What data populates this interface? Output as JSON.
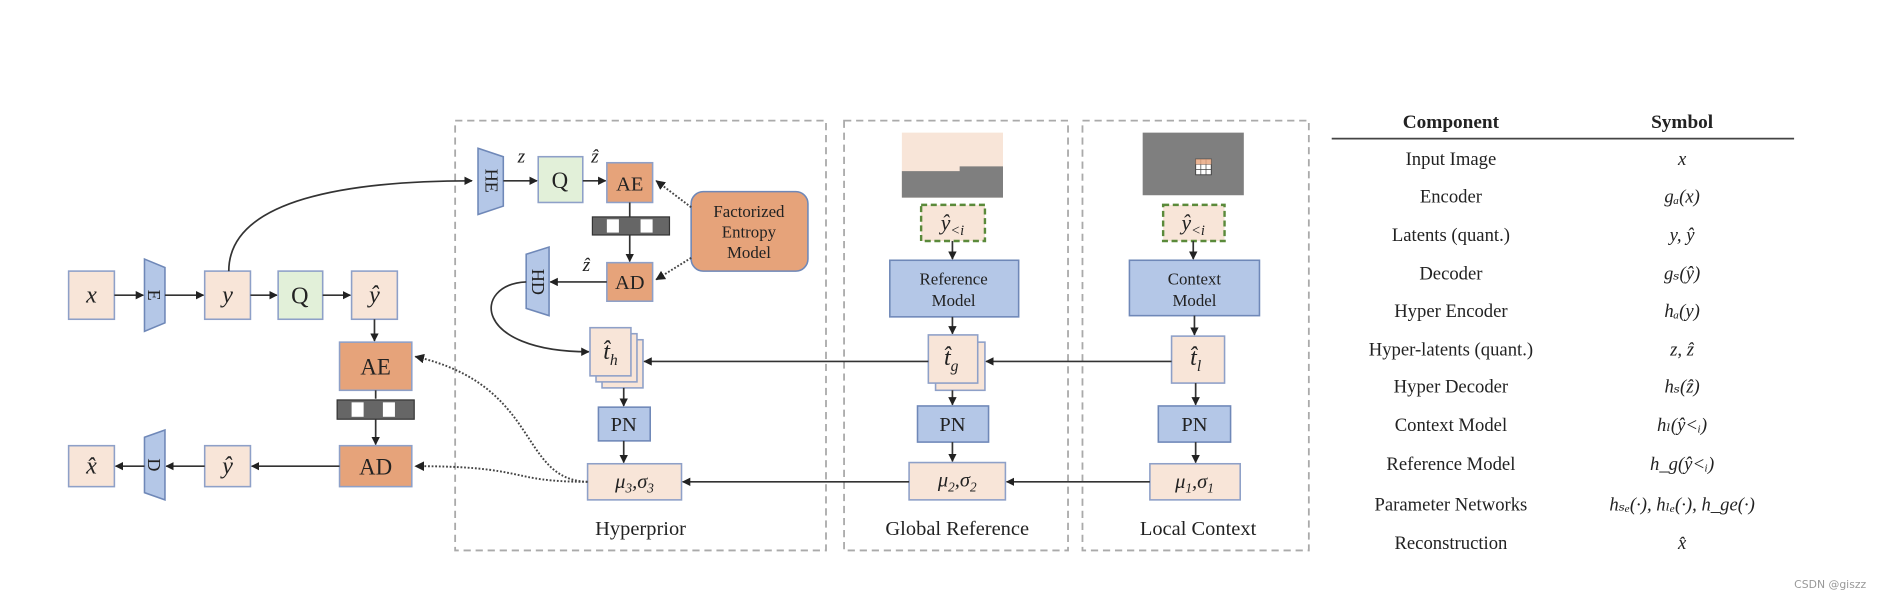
{
  "colors": {
    "latent": "#f8e5d8",
    "network": "#b4c7e7",
    "quantizer": "#e2f0d9",
    "coder": "#e6a37a"
  },
  "pipeline": {
    "x": "x",
    "E": "E",
    "y": "y",
    "Q": "Q",
    "y_hat": "ŷ",
    "AE": "AE",
    "AD": "AD",
    "x_hat": "x̂",
    "D": "D"
  },
  "hyperprior": {
    "title": "Hyperprior",
    "HE": "HE",
    "z": "z",
    "Q": "Q",
    "z_hat": "ẑ",
    "AE": "AE",
    "AD": "AD",
    "HD": "HD",
    "entropy_model": [
      "Factorized",
      "Entropy",
      "Model"
    ],
    "t_main": "t̂",
    "t_sub": "h",
    "PN": "PN",
    "mu": "μ",
    "mu_sub": "3",
    "sigma": "σ",
    "sigma_sub": "3"
  },
  "global_reference": {
    "title": "Global Reference",
    "y_main": "ŷ",
    "y_sub": "<i",
    "model": [
      "Reference",
      "Model"
    ],
    "t_main": "t̂",
    "t_sub": "g",
    "PN": "PN",
    "mu": "μ",
    "mu_sub": "2",
    "sigma": "σ",
    "sigma_sub": "2"
  },
  "local_context": {
    "title": "Local Context",
    "y_main": "ŷ",
    "y_sub": "<i",
    "model": [
      "Context",
      "Model"
    ],
    "t_main": "t̂",
    "t_sub": "l",
    "PN": "PN",
    "mu": "μ",
    "mu_sub": "1",
    "sigma": "σ",
    "sigma_sub": "1"
  },
  "table": {
    "headers": [
      "Component",
      "Symbol"
    ],
    "rows": [
      [
        "Input Image",
        "x"
      ],
      [
        "Encoder",
        "gₐ(x)"
      ],
      [
        "Latents (quant.)",
        "y, ŷ"
      ],
      [
        "Decoder",
        "gₛ(ŷ)"
      ],
      [
        "Hyper Encoder",
        "hₐ(y)"
      ],
      [
        "Hyper-latents (quant.)",
        "z, ẑ"
      ],
      [
        "Hyper Decoder",
        "hₛ(ẑ)"
      ],
      [
        "Context Model",
        "hₗ(ŷ<ᵢ)"
      ],
      [
        "Reference Model",
        "h_g(ŷ<ᵢ)"
      ],
      [
        "Parameter Networks",
        "hₛₑ(·), hₗₑ(·), h_ge(·)"
      ],
      [
        "Reconstruction",
        "x̂"
      ]
    ]
  },
  "watermark": "CSDN @giszz"
}
